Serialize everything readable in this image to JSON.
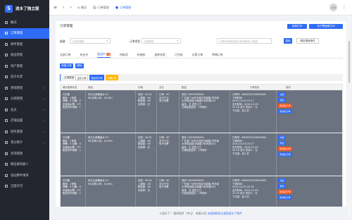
{
  "app": {
    "logo_glyph": "S",
    "title": "送水了独立版"
  },
  "sidebar": {
    "items": [
      {
        "label": "概况",
        "active": false,
        "arrow": ""
      },
      {
        "label": "订单管理",
        "active": true,
        "arrow": ""
      },
      {
        "label": "骑手管理",
        "active": false,
        "arrow": ""
      },
      {
        "label": "商品管理",
        "active": false,
        "arrow": ""
      },
      {
        "label": "用户管理",
        "active": false,
        "arrow": ""
      },
      {
        "label": "电子水票",
        "active": false,
        "arrow": ""
      },
      {
        "label": "营销管理",
        "active": false,
        "arrow": "›"
      },
      {
        "label": "分销管理",
        "active": false,
        "arrow": "›"
      },
      {
        "label": "会员",
        "active": false,
        "arrow": "›"
      },
      {
        "label": "店铺设置",
        "active": false,
        "arrow": "›"
      },
      {
        "label": "财务管理",
        "active": false,
        "arrow": "›"
      },
      {
        "label": "某分统计",
        "active": false,
        "arrow": "›"
      },
      {
        "label": "咨询管理",
        "active": false,
        "arrow": ""
      },
      {
        "label": "微信群机器人",
        "active": false,
        "arrow": ""
      },
      {
        "label": "电动牌申请系",
        "active": false,
        "arrow": ""
      },
      {
        "label": "正版许可",
        "active": false,
        "arrow": ""
      }
    ]
  },
  "topbar": {
    "menu_icon": "≡",
    "back_icon": "‹",
    "forward_icon": "›",
    "crumbs": [
      {
        "icon": "⌂",
        "label": "概况",
        "active": false
      },
      {
        "icon": "▤",
        "label": "订单管理",
        "active": false
      },
      {
        "icon": "●",
        "label": "订单管理",
        "active": true
      }
    ],
    "avatar": "头像",
    "more_icon": "⋮"
  },
  "panel": {
    "title": "订单管理",
    "btn_print_plain": "按单打印",
    "btn_print_sheet": "电子票面单打印",
    "filter": {
      "label_channel": "渠道",
      "channel_placeholder": "请选择渠道",
      "label_type": "订单类型",
      "type_placeholder": "全部类型",
      "search_placeholder": "订单号/商品名称/手机号/联系人/配送",
      "search_btn": "搜索",
      "clear_btn": "清空搜索条件"
    },
    "tabs": [
      {
        "label": "全部订单",
        "badge": "",
        "active": false
      },
      {
        "label": "待支付",
        "badge": "",
        "active": false
      },
      {
        "label": "配送中",
        "badge": "76",
        "active": true
      },
      {
        "label": "待取消",
        "badge": "",
        "active": false
      },
      {
        "label": "待退款",
        "badge": "",
        "active": false
      },
      {
        "label": "退款失败",
        "badge": "",
        "active": false
      },
      {
        "label": "已完成",
        "badge": "",
        "active": false
      },
      {
        "label": "水票订单",
        "badge": "",
        "active": false
      },
      {
        "label": "押桶订单",
        "badge": "",
        "active": false
      }
    ],
    "action_new": "新建订单",
    "action_delete": "删除",
    "notice": {
      "prefix": "订单类型",
      "tags": [
        "送水订单",
        "配送员订单",
        "水票订单"
      ]
    },
    "table": {
      "headers": [
        "骑手接单状态",
        "商品",
        "价格",
        "支付",
        "配送",
        "订单信息",
        "操作"
      ],
      "rows": [
        {
          "rider": [
            "已分配",
            "微信：1号骑",
            "押桶：0 欠桶：0",
            "未使用水票：0个",
            "配送员申请数：1"
          ],
          "product": [
            "农夫山泉桶装水 X1",
            "¥0(自有)1份，(0×¥0)"
          ],
          "price": [
            "实收：¥0.01",
            "上楼费：¥0",
            "配送费：¥0",
            "优惠券：无"
          ],
          "pay": [
            "订单：¥0",
            "支付方式：",
            "电子水票"
          ],
          "delivery": [
            "测试 13000000000",
            "广东省广州市天河区华景路1号华景",
            "大学科技园(华景路1号)阿里101",
            "留言：无 送货上门",
            "已增加配送员：1号骑手"
          ],
          "order": [
            "订单号：8020201203000001",
            "下单时间：",
            "2020-12-03 22:17",
            "支付时间：2020-12-03",
            "22:18 支付 完成人：无",
            "下次送：送人员"
          ],
          "ops": [
            {
              "label": "派送",
              "color": "#2f6cf6"
            },
            {
              "label": "修改",
              "color": "#2f6cf6"
            },
            {
              "label": "取消此订单",
              "color": "#ff5722"
            },
            {
              "label": "取消此订单",
              "color": "#2f6cf6"
            }
          ]
        },
        {
          "rider": [
            "已分配",
            "微信：1号骑",
            "押桶：0 欠桶：0",
            "未使用水票：0个",
            "配送员申请数：1"
          ],
          "product": [
            "农夫山泉桶装水 X1",
            "¥0(自有)1份，(0×¥0)"
          ],
          "price": [
            "实收：¥0.01",
            "上楼费：¥0",
            "配送费：¥0",
            "优惠券：无"
          ],
          "pay": [
            "订单：¥0",
            "支付方式：",
            "电子水票"
          ],
          "delivery": [
            "测试 13000000000",
            "广东省广州市天河区华景路1号华景",
            "大学科技园(华景路1号)阿里101",
            "留言：无 送货上门",
            "已增加配送员：1号骑手"
          ],
          "order": [
            "订单号：8020201203000002",
            "下单时间：",
            "2020-12-03 22:17",
            "支付时间：2020-12-03",
            "22:18 支付 完成人：无",
            "下次送：送人员"
          ],
          "ops": [
            {
              "label": "派送",
              "color": "#2f6cf6"
            },
            {
              "label": "修改",
              "color": "#2f6cf6"
            },
            {
              "label": "取消此订单",
              "color": "#ff5722"
            },
            {
              "label": "取消此订单",
              "color": "#2f6cf6"
            }
          ]
        },
        {
          "rider": [
            "已分配",
            "微信：1号骑",
            "押桶：0 欠桶：0",
            "未使用水票：0个",
            "配送员申请数：1"
          ],
          "product": [
            "农夫山泉桶装水 X1",
            "¥0(自有)1份，(0×¥0)"
          ],
          "price": [
            "实收：¥0.01",
            "上楼费：¥0",
            "配送费：¥0",
            "优惠券：无"
          ],
          "pay": [
            "订单：¥0",
            "支付方式：",
            "电子水票"
          ],
          "delivery": [
            "测试 13000000000",
            "广东省广州市天河区华景路1号华景",
            "大学科技园(华景路1号)阿里101",
            "留言：无 送货上门",
            "已增加配送员：1号骑手"
          ],
          "order": [
            "订单号：8020201203000003",
            "下单时间：",
            "2020-12-03 22:16",
            "支付时间：2020-12-03",
            "22:16 支付 完成人：无",
            "下次送：送人员"
          ],
          "ops": [
            {
              "label": "派送",
              "color": "#2f6cf6"
            },
            {
              "label": "修改",
              "color": "#2f6cf6"
            },
            {
              "label": "取消此订单",
              "color": "#ff5722"
            },
            {
              "label": "取消此订单",
              "color": "#2f6cf6"
            }
          ]
        }
      ]
    }
  },
  "footer": {
    "text": "©送水了™ 泰邦软件（中山） 有限公司",
    "link": "未经授权禁止使用送水了软件"
  },
  "colors": {
    "accent": "#2f6cf6",
    "danger": "#ff5722",
    "sidebar_bg": "#23262e"
  }
}
